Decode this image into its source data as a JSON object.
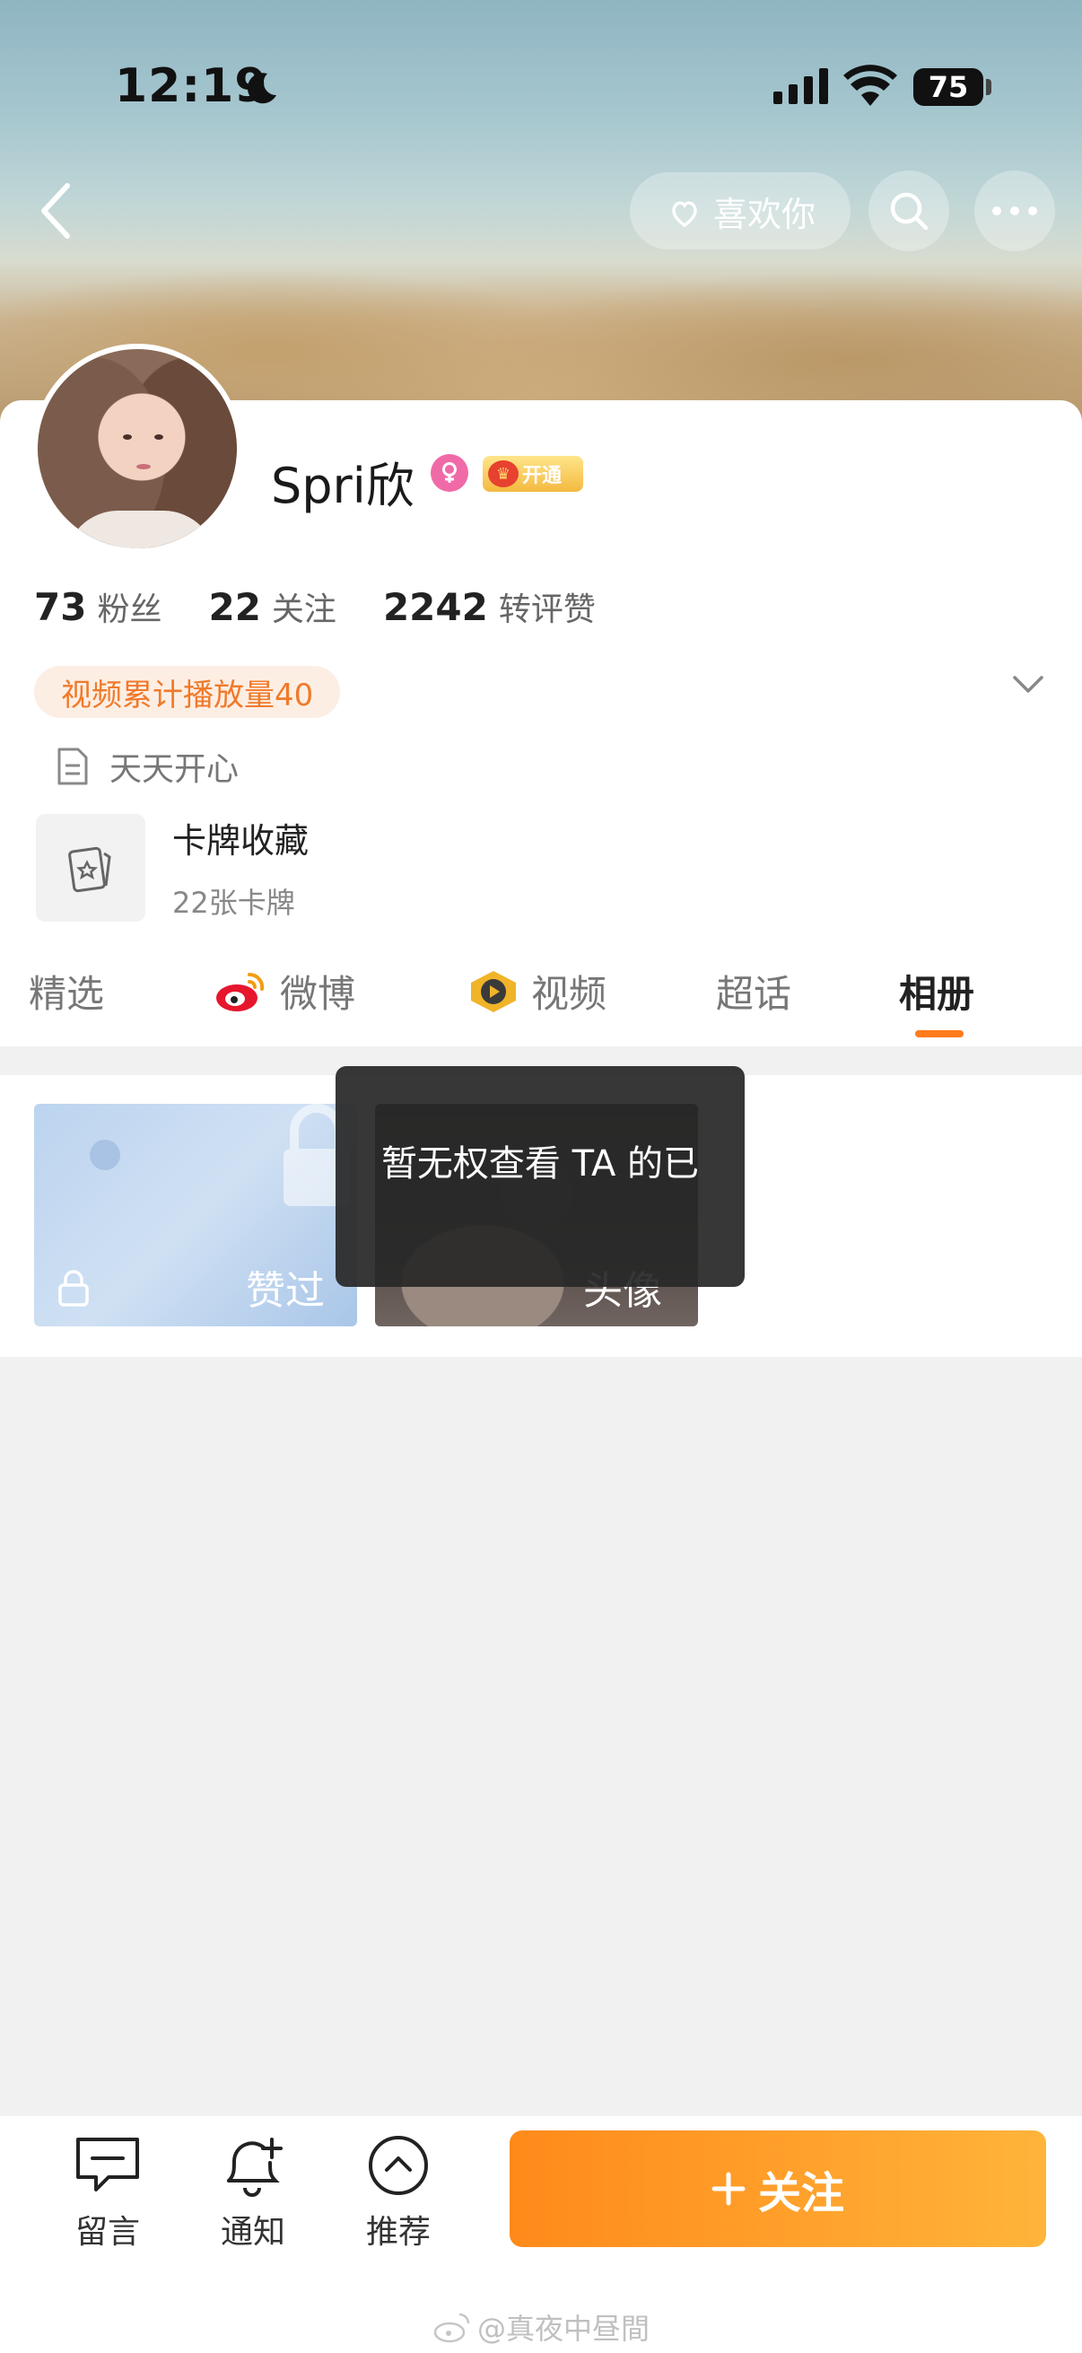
{
  "status_bar": {
    "time": "12:19",
    "battery": "75"
  },
  "header": {
    "like_label": "喜欢你"
  },
  "profile": {
    "username": "Spri欣",
    "vip_label": "开通",
    "stats": [
      {
        "num": "73",
        "label": "粉丝"
      },
      {
        "num": "22",
        "label": "关注"
      },
      {
        "num": "2242",
        "label": "转评赞"
      }
    ],
    "play_count": "视频累计播放量40",
    "bio": "天天开心",
    "cards": {
      "title": "卡牌收藏",
      "subtitle": "22张卡牌"
    }
  },
  "tabs": [
    "精选",
    "微博",
    "视频",
    "超话",
    "相册"
  ],
  "active_tab": "相册",
  "album": {
    "items": [
      {
        "label": "赞过"
      },
      {
        "label": "头像"
      }
    ]
  },
  "toast": "暂无权查看 TA 的已",
  "bottom": {
    "message": "留言",
    "notify": "通知",
    "recommend": "推荐",
    "follow": "关注"
  },
  "watermark": "@真夜中昼間",
  "colors": {
    "accent": "#ff7a1a",
    "follow_start": "#ff8a1a",
    "follow_end": "#ffb43a"
  }
}
